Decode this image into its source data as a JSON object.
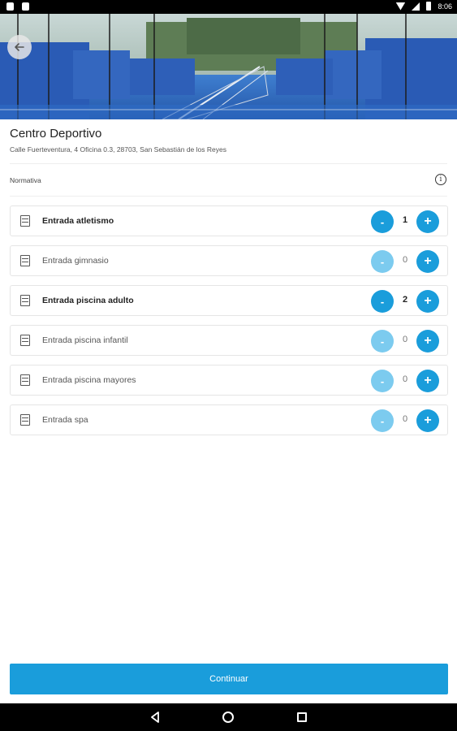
{
  "status_bar": {
    "time": "8:06"
  },
  "venue": {
    "name": "Centro Deportivo",
    "address": "Calle Fuerteventura, 4 Oficina 0.3, 28703, San Sebastián de los Reyes"
  },
  "normativa": {
    "label": "Normativa"
  },
  "tickets": [
    {
      "label": "Entrada atletismo",
      "quantity": "1",
      "minus": "-",
      "plus": "+"
    },
    {
      "label": "Entrada gimnasio",
      "quantity": "0",
      "minus": "-",
      "plus": "+"
    },
    {
      "label": "Entrada piscina adulto",
      "quantity": "2",
      "minus": "-",
      "plus": "+"
    },
    {
      "label": "Entrada piscina infantil",
      "quantity": "0",
      "minus": "-",
      "plus": "+"
    },
    {
      "label": "Entrada piscina mayores",
      "quantity": "0",
      "minus": "-",
      "plus": "+"
    },
    {
      "label": "Entrada spa",
      "quantity": "0",
      "minus": "-",
      "plus": "+"
    }
  ],
  "actions": {
    "continue_label": "Continuar"
  },
  "colors": {
    "accent": "#1a9ddb",
    "accent_disabled": "#7ccbef"
  }
}
